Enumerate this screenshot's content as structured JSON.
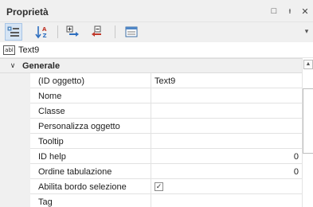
{
  "panel": {
    "title": "Proprietà",
    "window_buttons": {
      "restore": "□",
      "pin": "ᵻ",
      "close": "✕"
    }
  },
  "toolbar": {
    "buttons": [
      {
        "name": "categorized-view",
        "active": true
      },
      {
        "name": "alphabetical-sort",
        "active": false
      },
      {
        "name": "expand-all",
        "active": false
      },
      {
        "name": "collapse-all",
        "active": false
      },
      {
        "name": "property-pages",
        "active": false
      }
    ],
    "overflow": "▾"
  },
  "object": {
    "icon_text": "abl",
    "name": "Text9"
  },
  "grid": {
    "category": {
      "label": "Generale",
      "expanded": true,
      "toggle": "∨"
    },
    "rows": [
      {
        "name": "(ID oggetto)",
        "value": "Text9"
      },
      {
        "name": "Nome",
        "value": ""
      },
      {
        "name": "Classe",
        "value": ""
      },
      {
        "name": "Personalizza oggetto",
        "value": ""
      },
      {
        "name": "Tooltip",
        "value": ""
      },
      {
        "name": "ID help",
        "value": "0"
      },
      {
        "name": "Ordine tabulazione",
        "value": "0"
      },
      {
        "name": "Abilita bordo selezione",
        "value": "",
        "checked": true,
        "check_glyph": "✓"
      },
      {
        "name": "Tag",
        "value": ""
      }
    ]
  },
  "scrollbar": {
    "up_arrow": "▲"
  },
  "colors": {
    "panel_bg": "#f0f0f0",
    "active_button_bg": "#d5e4f4",
    "grid_line": "#e2e2e2"
  }
}
